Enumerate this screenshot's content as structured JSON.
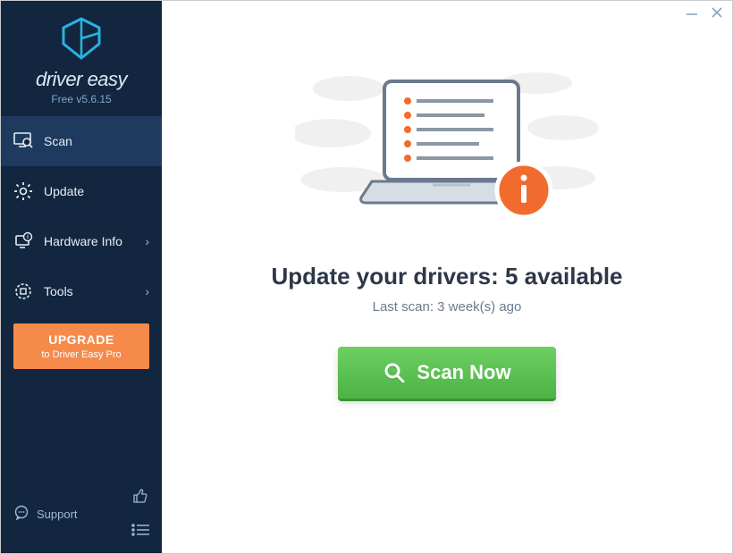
{
  "app": {
    "name": "driver easy",
    "version_label": "Free v5.6.15"
  },
  "sidebar": {
    "items": [
      {
        "label": "Scan",
        "has_chevron": false
      },
      {
        "label": "Update",
        "has_chevron": false
      },
      {
        "label": "Hardware Info",
        "has_chevron": true
      },
      {
        "label": "Tools",
        "has_chevron": true
      }
    ],
    "upgrade": {
      "line1": "UPGRADE",
      "line2": "to Driver Easy Pro"
    },
    "support_label": "Support"
  },
  "main": {
    "headline": "Update your drivers: 5 available",
    "subline": "Last scan: 3 week(s) ago",
    "scan_button": "Scan Now"
  },
  "colors": {
    "sidebar_bg": "#12263f",
    "accent_orange": "#f68a4a",
    "scan_green": "#4db344",
    "info_orange": "#f26b2e"
  }
}
